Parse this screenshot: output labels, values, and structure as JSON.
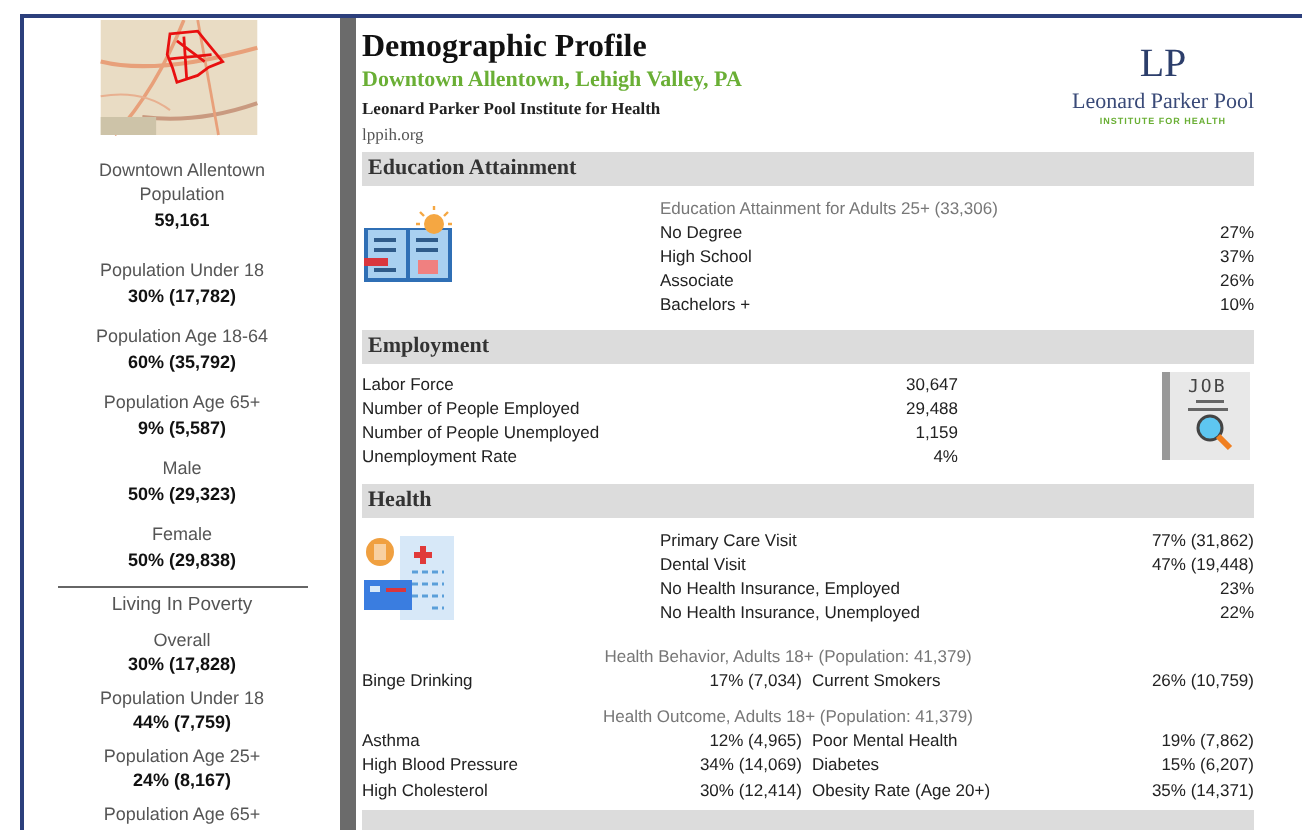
{
  "sidebar": {
    "area_name": "Downtown Allentown",
    "population_label": "Population",
    "population_value": "59,161",
    "stats": [
      {
        "label": "Population Under 18",
        "value": "30% (17,782)"
      },
      {
        "label": "Population Age 18-64",
        "value": "60% (35,792)"
      },
      {
        "label": "Population Age 65+",
        "value": "9% (5,587)"
      },
      {
        "label": "Male",
        "value": "50% (29,323)"
      },
      {
        "label": "Female",
        "value": "50% (29,838)"
      }
    ],
    "poverty_heading": "Living In Poverty",
    "poverty_stats": [
      {
        "label": "Overall",
        "value": "30% (17,828)"
      },
      {
        "label": "Population Under 18",
        "value": "44% (7,759)"
      },
      {
        "label": "Population Age 25+",
        "value": "24% (8,167)"
      },
      {
        "label": "Population Age 65+"
      }
    ]
  },
  "header": {
    "title": "Demographic Profile",
    "subtitle": "Downtown Allentown, Lehigh Valley, PA",
    "organization": "Leonard Parker Pool Institute for Health",
    "website": "lppih.org",
    "logo": {
      "monogram": "LP",
      "name": "Leonard Parker Pool",
      "tagline": "INSTITUTE FOR HEALTH"
    }
  },
  "education": {
    "heading": "Education Attainment",
    "subheading": "Education Attainment for Adults 25+ (33,306)",
    "rows": [
      {
        "label": "No Degree",
        "value": "27%"
      },
      {
        "label": "High School",
        "value": "37%"
      },
      {
        "label": "Associate",
        "value": "26%"
      },
      {
        "label": "Bachelors +",
        "value": "10%"
      }
    ]
  },
  "employment": {
    "heading": "Employment",
    "icon_label": "JOB",
    "rows": [
      {
        "label": "Labor Force",
        "value": "30,647"
      },
      {
        "label": "Number of People Employed",
        "value": "29,488"
      },
      {
        "label": "Number of People Unemployed",
        "value": "1,159"
      },
      {
        "label": "Unemployment Rate",
        "value": "4%"
      }
    ]
  },
  "health": {
    "heading": "Health",
    "rows": [
      {
        "label": "Primary Care Visit",
        "value": "77% (31,862)"
      },
      {
        "label": "Dental Visit",
        "value": "47% (19,448)"
      },
      {
        "label": "No Health Insurance, Employed",
        "value": "23%"
      },
      {
        "label": "No Health Insurance, Unemployed",
        "value": "22%"
      }
    ],
    "groups": [
      {
        "heading": "Health Behavior, Adults 18+ (Population: 41,379)",
        "pairs": [
          {
            "left_label": "Binge Drinking",
            "left_value": "17% (7,034)",
            "right_label": "Current Smokers",
            "right_value": "26% (10,759)"
          }
        ]
      },
      {
        "heading": "Health Outcome, Adults 18+ (Population: 41,379)",
        "pairs": [
          {
            "left_label": "Asthma",
            "left_value": "12% (4,965)",
            "right_label": "Poor Mental Health",
            "right_value": "19% (7,862)"
          },
          {
            "left_label": "High Blood Pressure",
            "left_value": "34% (14,069)",
            "right_label": "Diabetes",
            "right_value": "15% (6,207)"
          },
          {
            "left_label": "High Cholesterol",
            "left_value": "30% (12,414)",
            "right_label": "Obesity Rate (Age 20+)",
            "right_value": "35% (14,371)"
          }
        ]
      }
    ]
  }
}
